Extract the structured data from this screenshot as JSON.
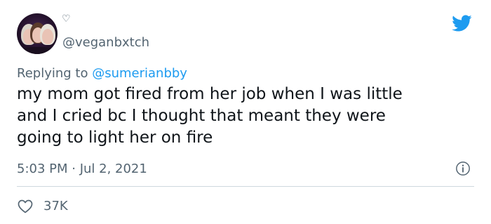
{
  "user": {
    "handle": "@veganbxtch",
    "badge_icon": "heart-outline-icon"
  },
  "reply": {
    "prefix": "Replying to ",
    "mention": "@sumerianbby"
  },
  "tweet": {
    "lines": [
      "my mom got fired from her job when I was little",
      "and I cried bc I thought that meant they were",
      "going to light her on fire"
    ],
    "timestamp": "5:03 PM · Jul 2, 2021"
  },
  "stats": {
    "likes": "37K"
  },
  "colors": {
    "brand_blue": "#1d9bf0",
    "secondary_text": "#536471",
    "primary_text": "#0f1419",
    "divider": "#cfd9de"
  },
  "icons": {
    "brand": "twitter-bird-icon",
    "info": "info-icon",
    "like": "heart-icon"
  }
}
